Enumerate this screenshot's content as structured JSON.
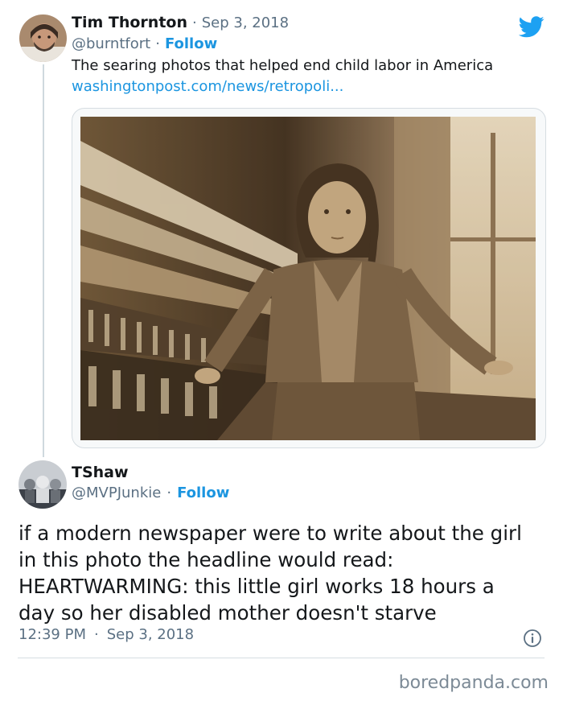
{
  "tweet1": {
    "author_name": "Tim Thornton",
    "date": "Sep 3, 2018",
    "handle": "@burntfort",
    "follow": "Follow",
    "text": "The searing photos that helped end child labor in America",
    "link": "washingtonpost.com/news/retropoli..."
  },
  "tweet2": {
    "author_name": "TShaw",
    "handle": "@MVPJunkie",
    "follow": "Follow",
    "text_lines": [
      "if a modern newspaper were to write about the girl",
      "in this photo the headline would read:",
      "HEARTWARMING: this little girl works 18 hours a",
      "day so her disabled mother doesn't starve"
    ],
    "time": "12:39 PM",
    "date": "Sep 3, 2018"
  },
  "separator": "·",
  "watermark": "boredpanda.com",
  "colors": {
    "accent": "#1b95e0",
    "twitter_blue": "#1da1f2",
    "muted": "#5b7083",
    "photo_sepia": "#8a6f48"
  },
  "icons": {
    "brand": "twitter-bird-icon",
    "info": "info-icon"
  }
}
